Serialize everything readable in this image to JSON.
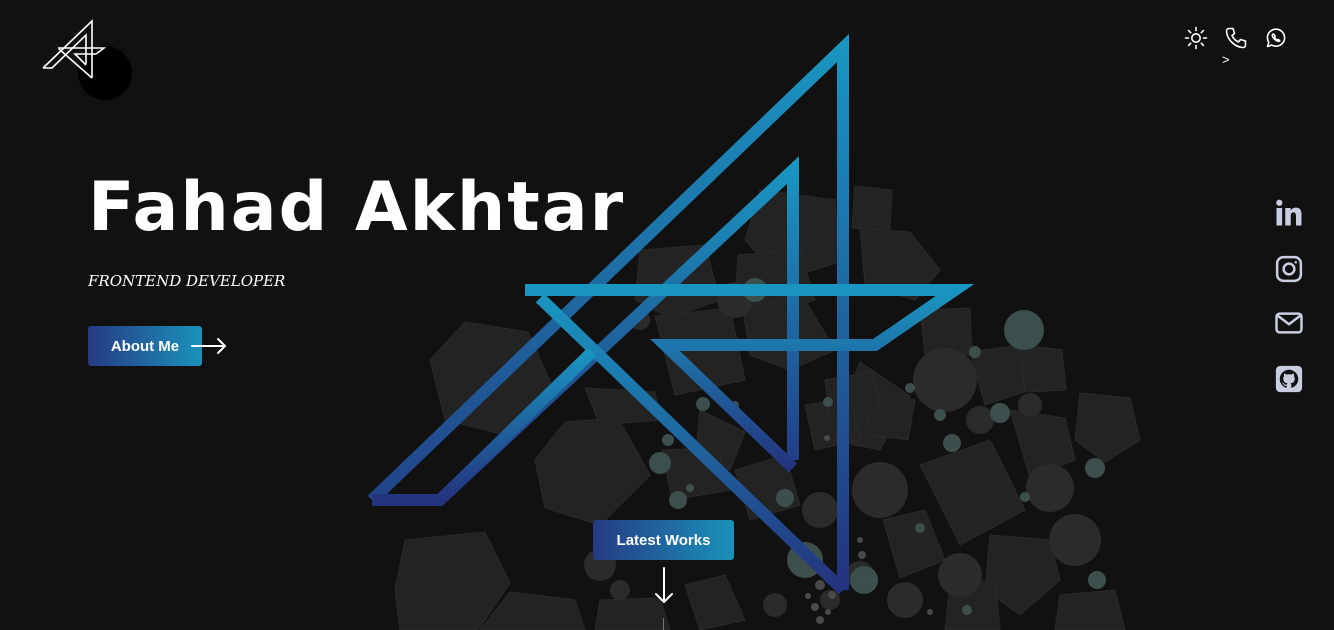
{
  "hero": {
    "name": "Fahad Akhtar",
    "role": "FRONTEND DEVELOPER",
    "about_label": "About Me",
    "works_label": "Latest Works"
  },
  "header": {
    "icons": [
      "sun-icon",
      "phone-icon",
      "whatsapp-icon"
    ],
    "caret": ">"
  },
  "social": {
    "icons": [
      "linkedin-icon",
      "instagram-icon",
      "mail-icon",
      "github-icon"
    ]
  },
  "colors": {
    "background": "#111111",
    "accent_start": "#263a84",
    "accent_end": "#1a92bc",
    "social_icon": "#c9cde0",
    "polygon_fill": "#232323",
    "bubble_fill": "#3d4f4d"
  }
}
